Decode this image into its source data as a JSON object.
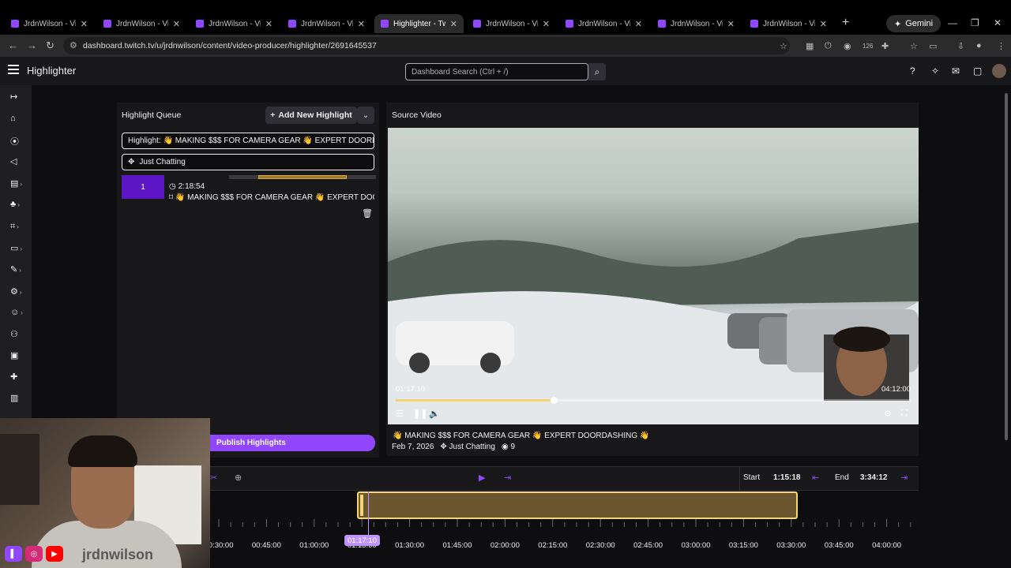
{
  "browser": {
    "tabs": [
      {
        "title": "JrdnWilson - Video",
        "active": false
      },
      {
        "title": "JrdnWilson - Video",
        "active": false
      },
      {
        "title": "JrdnWilson - Video",
        "active": false
      },
      {
        "title": "JrdnWilson - Video",
        "active": false
      },
      {
        "title": "Highlighter - Tw",
        "active": true
      },
      {
        "title": "JrdnWilson - Vi",
        "active": false
      },
      {
        "title": "JrdnWilson - Vi",
        "active": false
      },
      {
        "title": "JrdnWilson - Vi",
        "active": false
      },
      {
        "title": "JrdnWilson - Vi",
        "active": false
      }
    ],
    "gemini_label": "Gemini",
    "url": "dashboard.twitch.tv/u/jrdnwilson/content/video-producer/highlighter/2691645537",
    "extension_badge": "126"
  },
  "app": {
    "title": "Highlighter",
    "search_placeholder": "Dashboard Search (Ctrl + /)"
  },
  "queue": {
    "header": "Highlight Queue",
    "add_label": "Add New Highlight",
    "highlight_title": "Highlight: 👋 MAKING $$$ FOR CAMERA GEAR 👋 EXPERT DOORDASHING",
    "category": "Just Chatting",
    "items": [
      {
        "number": "1",
        "duration": "2:18:54",
        "title": "👋 MAKING $$$ FOR CAMERA GEAR 👋 EXPERT DOORDASHING",
        "range_start": 0.2,
        "range_end": 0.8
      }
    ],
    "publish_label": "Publish Highlights"
  },
  "source": {
    "header": "Source Video",
    "current_time": "01:17:10",
    "end_time": "04:12:00",
    "progress": 0.306,
    "video_title": "👋 MAKING $$$ FOR CAMERA GEAR 👋 EXPERT DOORDASHING 👋",
    "date": "Feb 7, 2026",
    "category": "Just Chatting",
    "views": "9"
  },
  "timeline": {
    "start_label": "Start",
    "start_value": "1:15:18",
    "end_label": "End",
    "end_value": "3:34:12",
    "playhead_time": "01:17:10",
    "labels": [
      "00:30:00",
      "00:45:00",
      "01:00:00",
      "01:15:00",
      "01:30:00",
      "01:45:00",
      "02:00:00",
      "02:15:00",
      "02:30:00",
      "02:45:00",
      "03:00:00",
      "03:15:00",
      "03:30:00",
      "03:45:00",
      "04:00:00"
    ]
  },
  "overlay": {
    "handle": "jrdnwilson"
  },
  "colors": {
    "accent": "#9147ff",
    "clip": "#f5d47a",
    "background": "#0e0e10"
  }
}
